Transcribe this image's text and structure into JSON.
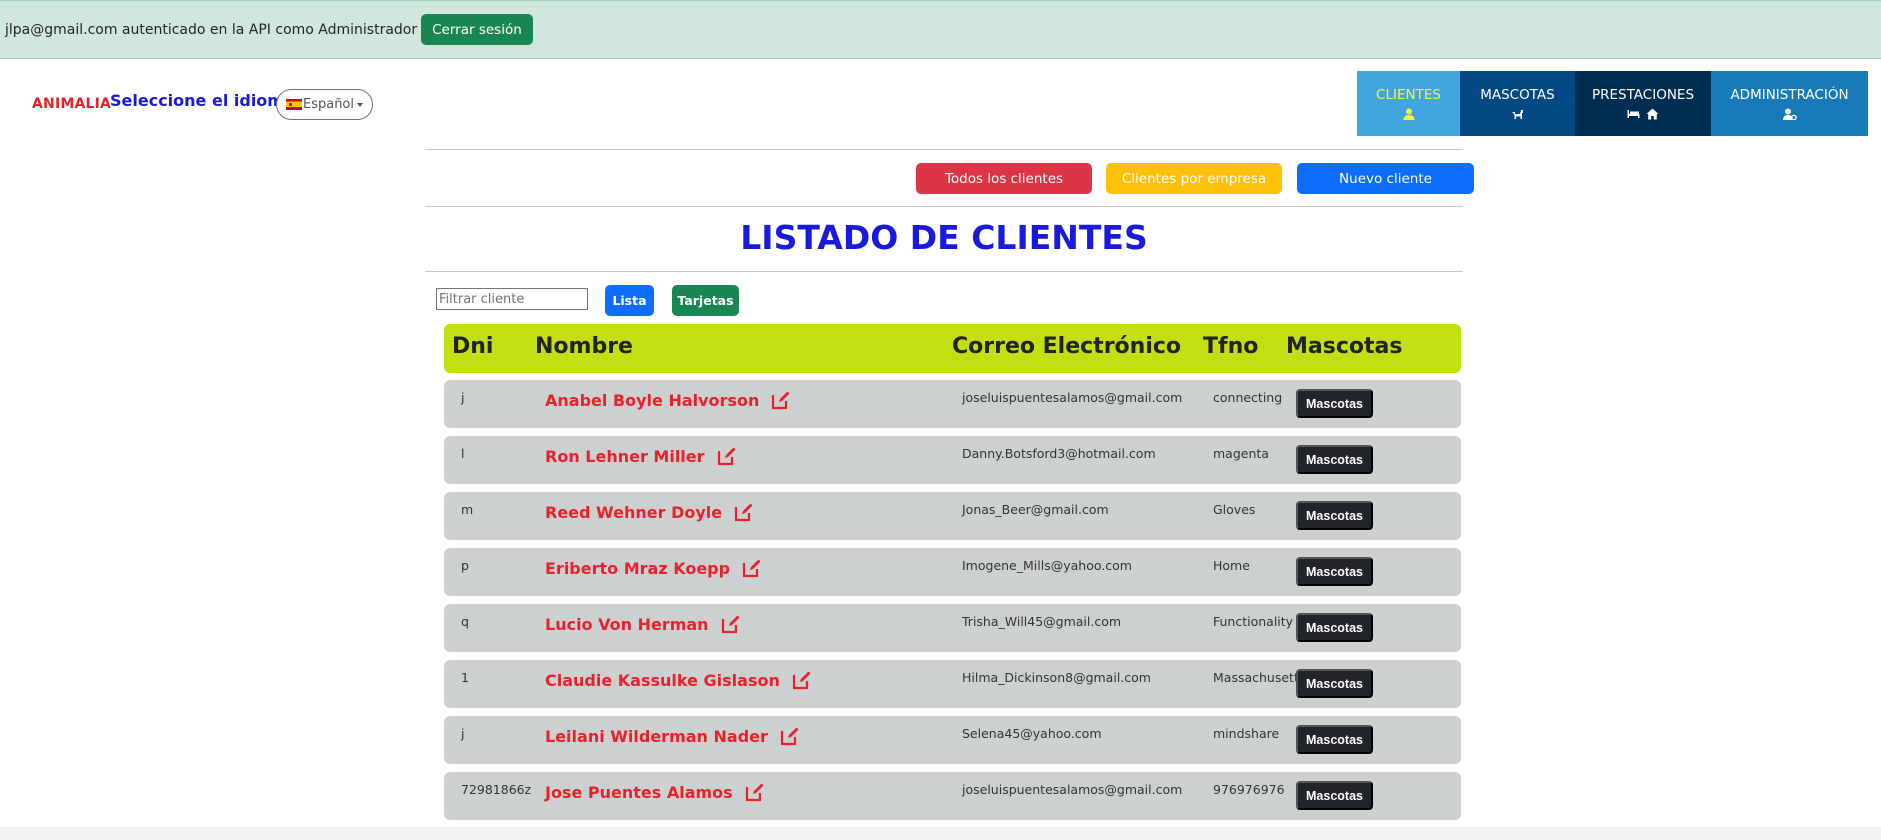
{
  "auth": {
    "message": "jlpa@gmail.com autenticado en la API como Administrador",
    "logout_label": "Cerrar sesión"
  },
  "header": {
    "brand": "ANIMALIA",
    "language_label": "Seleccione el idioma:",
    "language_selected": "Español"
  },
  "nav": {
    "items": [
      {
        "label": "CLIENTES",
        "icon": "user-icon",
        "active": true
      },
      {
        "label": "MASCOTAS",
        "icon": "dog-icon",
        "active": false
      },
      {
        "label": "PRESTACIONES",
        "icon": "bed-home-icon",
        "active": false
      },
      {
        "label": "ADMINISTRACIÓN",
        "icon": "user-gear-icon",
        "active": false
      }
    ]
  },
  "actions": {
    "todos": "Todos los clientes",
    "empresa": "Clientes por empresa",
    "nuevo": "Nuevo cliente"
  },
  "page": {
    "title": "LISTADO DE CLIENTES",
    "filter_placeholder": "Filtrar cliente",
    "view_lista": "Lista",
    "view_tarjetas": "Tarjetas"
  },
  "table": {
    "headers": [
      "Dni",
      "Nombre",
      "Correo Electrónico",
      "Tfno",
      "Mascotas"
    ],
    "rows": [
      {
        "dni": "j",
        "nombre": "Anabel Boyle Halvorson",
        "email": "joseluispuentesalamos@gmail.com",
        "tfno": "connecting",
        "mascotas": "Mascotas"
      },
      {
        "dni": "l",
        "nombre": "Ron Lehner Miller",
        "email": "Danny.Botsford3@hotmail.com",
        "tfno": "magenta",
        "mascotas": "Mascotas"
      },
      {
        "dni": "m",
        "nombre": "Reed Wehner Doyle",
        "email": "Jonas_Beer@gmail.com",
        "tfno": "Gloves",
        "mascotas": "Mascotas"
      },
      {
        "dni": "p",
        "nombre": "Eriberto Mraz Koepp",
        "email": "Imogene_Mills@yahoo.com",
        "tfno": "Home",
        "mascotas": "Mascotas"
      },
      {
        "dni": "q",
        "nombre": "Lucio Von Herman",
        "email": "Trisha_Will45@gmail.com",
        "tfno": "Functionality",
        "mascotas": "Mascotas"
      },
      {
        "dni": "1",
        "nombre": "Claudie Kassulke Gislason",
        "email": "Hilma_Dickinson8@gmail.com",
        "tfno": "Massachusetts",
        "mascotas": "Mascotas"
      },
      {
        "dni": "j",
        "nombre": "Leilani Wilderman Nader",
        "email": "Selena45@yahoo.com",
        "tfno": "mindshare",
        "mascotas": "Mascotas"
      },
      {
        "dni": "72981866z",
        "nombre": "Jose Puentes Alamos",
        "email": "joseluispuentesalamos@gmail.com",
        "tfno": "976976976",
        "mascotas": "Mascotas"
      }
    ]
  },
  "colors": {
    "brand_red": "#e8212a",
    "title_blue": "#1a1add",
    "header_lime": "#c2df12",
    "row_gray": "#cdd0d1"
  }
}
